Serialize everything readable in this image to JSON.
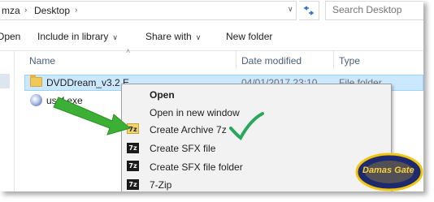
{
  "address_bar": {
    "segments": [
      "mza",
      "Desktop"
    ],
    "refresh_icon": "refresh-icon"
  },
  "search": {
    "placeholder": "Search Desktop"
  },
  "toolbar": {
    "open_label": "Open",
    "include_label": "Include in library",
    "share_label": "Share with",
    "new_folder_label": "New folder"
  },
  "columns": {
    "name": "Name",
    "date_modified": "Date modified",
    "type": "Type"
  },
  "files": [
    {
      "name": "DVDDream_v3.2.E",
      "date": "04/01/2017 23:10",
      "type": "File folder",
      "icon": "folder-icon"
    },
    {
      "name": "ussf.exe",
      "date": "",
      "type": "",
      "icon": "exe-icon"
    }
  ],
  "context_menu": {
    "items": [
      {
        "label": "Open",
        "bold": true
      },
      {
        "label": "Open in new window"
      },
      {
        "label": "Create Archive 7z",
        "icon": "7z-folder-icon"
      },
      {
        "label": "Create SFX file",
        "icon": "7z-icon"
      },
      {
        "label": "Create SFX file folder",
        "icon": "7z-icon"
      },
      {
        "label": "7-Zip",
        "icon": "7z-icon",
        "submenu": true
      }
    ],
    "icon_glyph": "7z"
  },
  "watermark": {
    "text": "Damas Gate"
  },
  "colors": {
    "selection": "#cce8ff",
    "arrow_green": "#3cb034",
    "check_green": "#27a85a"
  }
}
